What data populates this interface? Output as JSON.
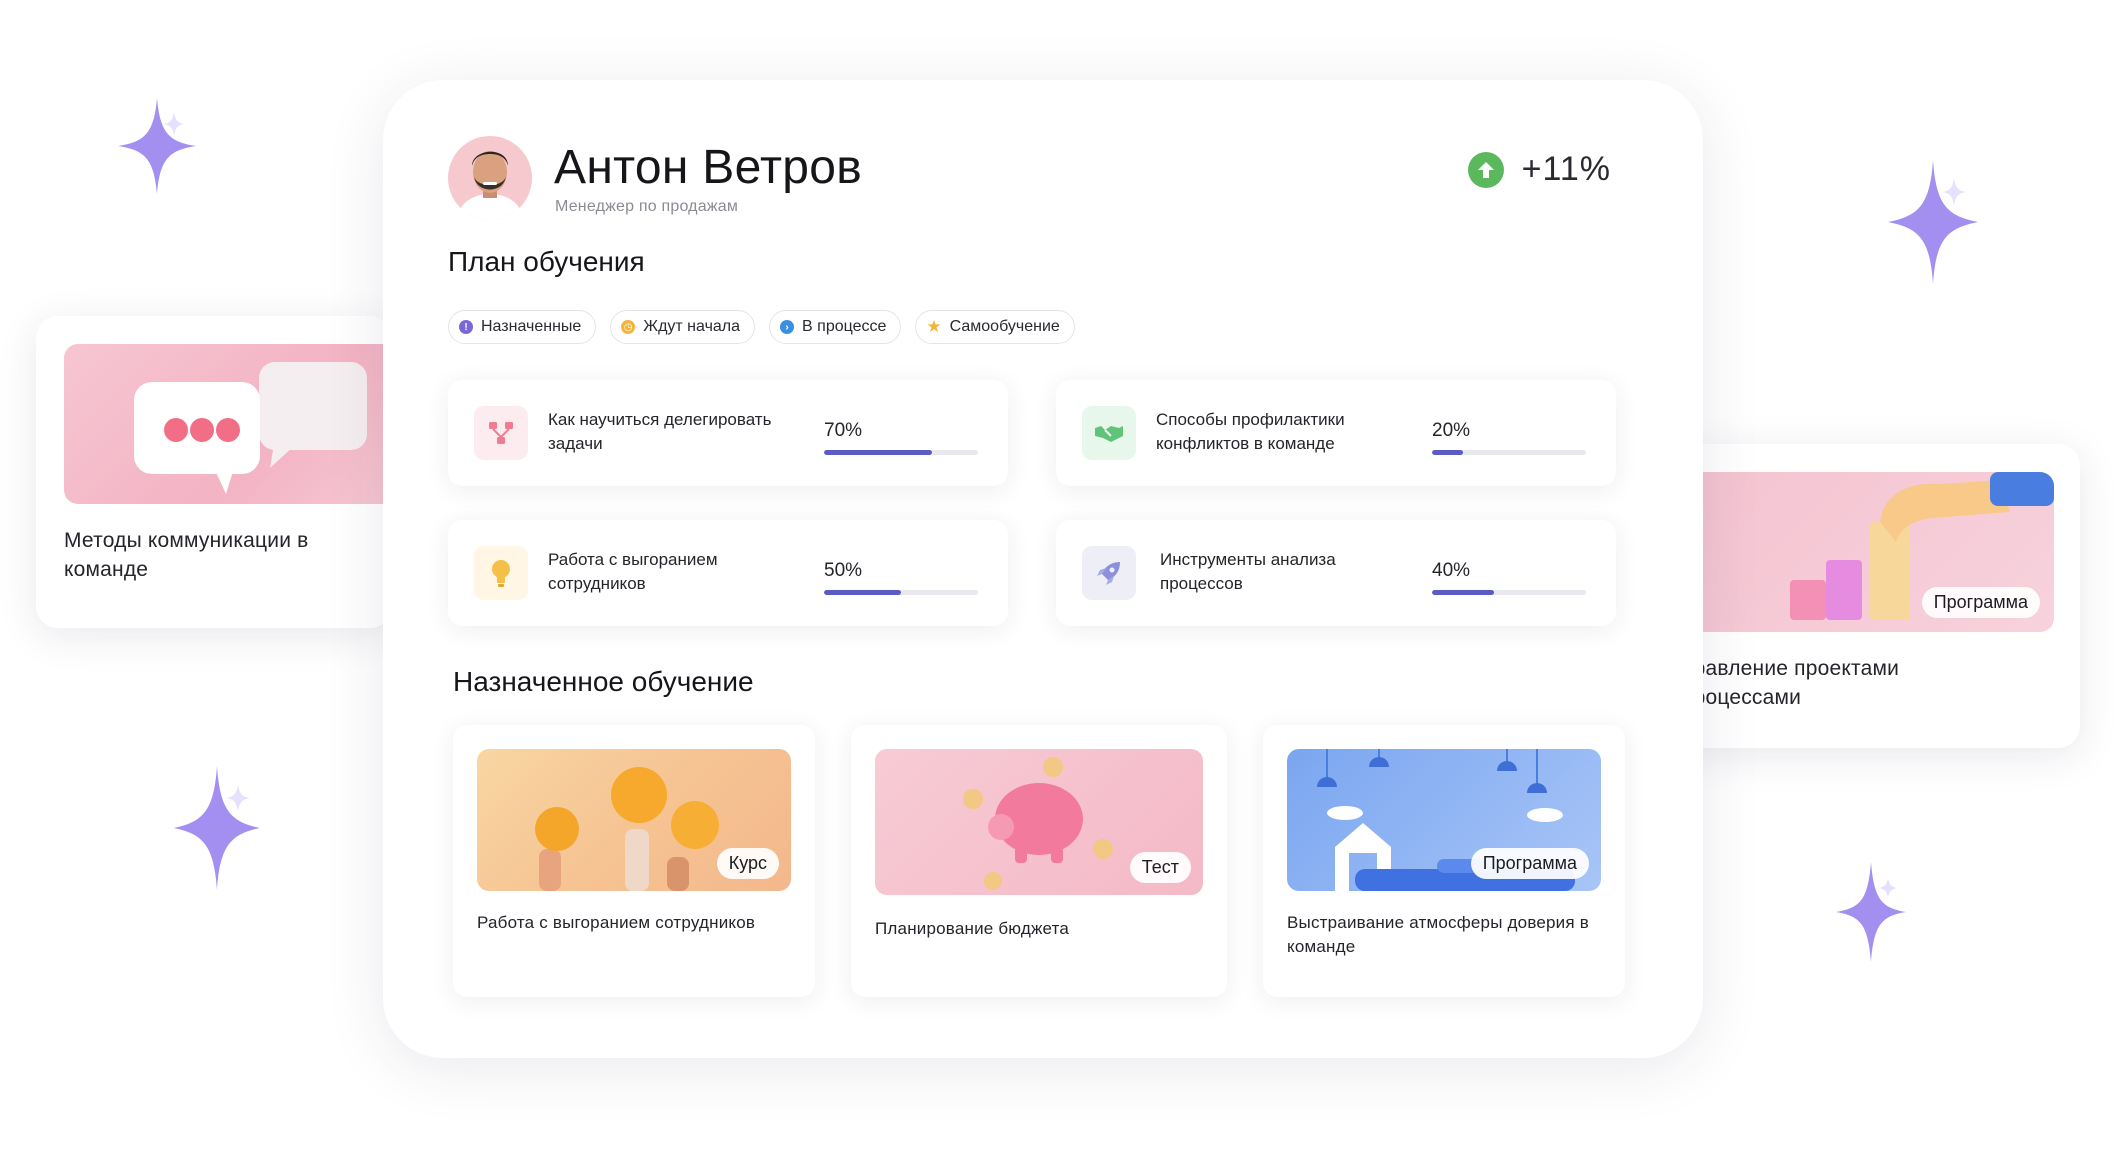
{
  "user": {
    "name": "Антон Ветров",
    "role": "Менеджер по продажам",
    "growth": "+11%"
  },
  "plan": {
    "title": "План обучения",
    "filters": [
      {
        "label": "Назначенные",
        "color": "#7b68d6"
      },
      {
        "label": "Ждут начала",
        "color": "#f2b53a"
      },
      {
        "label": "В процессе",
        "color": "#3b8fe0"
      },
      {
        "label": "Самообучение",
        "color": "#f2b53a"
      }
    ],
    "items": [
      {
        "title": "Как научиться делегировать задачи",
        "percent_label": "70%",
        "percent": 70,
        "icon": "hierarchy-icon"
      },
      {
        "title": "Способы профилактики конфликтов в команде",
        "percent_label": "20%",
        "percent": 20,
        "icon": "handshake-icon"
      },
      {
        "title": "Работа с выгоранием сотрудников",
        "percent_label": "50%",
        "percent": 50,
        "icon": "lightbulb-icon"
      },
      {
        "title": "Инструменты анализа процессов",
        "percent_label": "40%",
        "percent": 40,
        "icon": "rocket-icon"
      }
    ]
  },
  "assigned": {
    "title": "Назначенное обучение",
    "courses": [
      {
        "badge": "Курс",
        "title": "Работа с выгоранием сотрудников"
      },
      {
        "badge": "Тест",
        "title": "Планирование бюджета"
      },
      {
        "badge": "Программа",
        "title": "Выстраивание атмосферы доверия в команде"
      }
    ]
  },
  "side_left": {
    "title": "Методы коммуникации в команде"
  },
  "side_right": {
    "badge": "Программа",
    "title": "правление проектами\n процессами"
  },
  "colors": {
    "accent": "#5b5bc4",
    "sparkle": "#a28ff0",
    "growth": "#5cb85c"
  }
}
